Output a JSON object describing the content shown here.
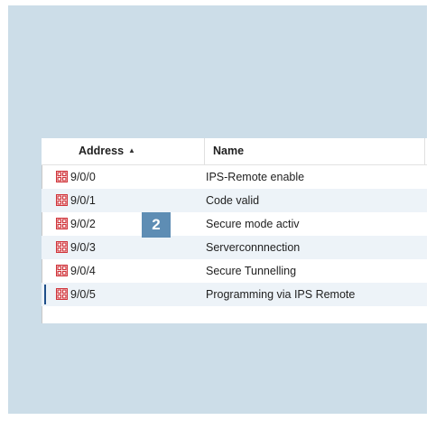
{
  "table": {
    "columns": {
      "address": "Address",
      "address_sort": "▲",
      "name": "Name"
    },
    "rows": [
      {
        "address": "9/0/0",
        "name": "IPS-Remote enable",
        "selected": false
      },
      {
        "address": "9/0/1",
        "name": "Code valid",
        "selected": false
      },
      {
        "address": "9/0/2",
        "name": "Secure mode activ",
        "selected": false
      },
      {
        "address": "9/0/3",
        "name": "Serverconnnection",
        "selected": false
      },
      {
        "address": "9/0/4",
        "name": "Secure Tunnelling",
        "selected": false
      },
      {
        "address": "9/0/5",
        "name": "Programming via IPS Remote",
        "selected": true
      }
    ],
    "icon": "group-address-icon",
    "icon_color": "#d0343a",
    "alt_row_color": "#edf3f8"
  },
  "badge": {
    "label": "2",
    "color": "#5e8db4"
  },
  "panel_color": "#ccdde8"
}
